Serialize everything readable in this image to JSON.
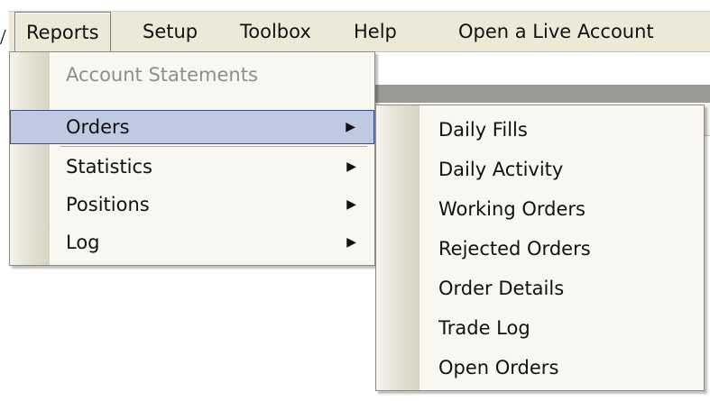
{
  "menubar": {
    "items": [
      {
        "label": "Reports"
      },
      {
        "label": "Setup"
      },
      {
        "label": "Toolbox"
      },
      {
        "label": "Help"
      },
      {
        "label": "Open a Live Account"
      }
    ]
  },
  "reports_menu": {
    "items": [
      {
        "label": "Account Statements",
        "disabled": true
      },
      {
        "label": "Orders",
        "has_submenu": true,
        "highlighted": true
      },
      {
        "label": "Statistics",
        "has_submenu": true
      },
      {
        "label": "Positions",
        "has_submenu": true
      },
      {
        "label": "Log",
        "has_submenu": true
      }
    ],
    "submenu_arrow_icon": "triangle-right-icon"
  },
  "orders_submenu": {
    "items": [
      {
        "label": "Daily Fills"
      },
      {
        "label": "Daily Activity"
      },
      {
        "label": "Working Orders"
      },
      {
        "label": "Rejected Orders"
      },
      {
        "label": "Order Details"
      },
      {
        "label": "Trade Log"
      },
      {
        "label": "Open Orders"
      }
    ]
  },
  "colors": {
    "menubar_bg": "#ece9d8",
    "menu_bg": "#f8f7f1",
    "highlight_bg": "#c0c9e2",
    "highlight_border": "#35508f",
    "disabled_text": "#8e8e8e"
  }
}
